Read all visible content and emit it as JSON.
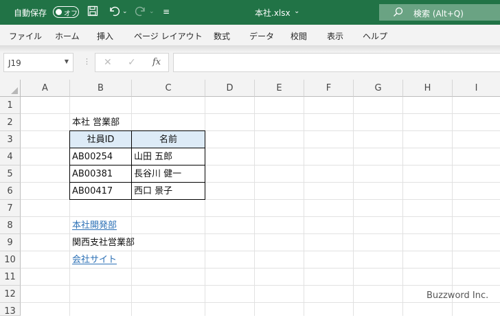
{
  "titlebar": {
    "autosave_label": "自動保存",
    "autosave_state": "オフ",
    "filename": "本社.xlsx",
    "search_label": "検索 (Alt+Q)",
    "bg_color": "#217346"
  },
  "ribbon": {
    "tabs": [
      "ファイル",
      "ホーム",
      "挿入",
      "ページ レイアウト",
      "数式",
      "データ",
      "校閲",
      "表示",
      "ヘルプ"
    ]
  },
  "formula_bar": {
    "name_box": "J19",
    "fx_label": "fx",
    "formula": ""
  },
  "sheet": {
    "columns": [
      "A",
      "B",
      "C",
      "D",
      "E",
      "F",
      "G",
      "H",
      "I"
    ],
    "rows": [
      "1",
      "2",
      "3",
      "4",
      "5",
      "6",
      "7",
      "8",
      "9",
      "10",
      "11",
      "12",
      "13"
    ],
    "cells": {
      "B2": "本社 営業部",
      "B3": "社員ID",
      "C3": "名前",
      "B4": "AB00254",
      "C4": "山田 五郎",
      "B5": "AB00381",
      "C5": "長谷川 健一",
      "B6": "AB00417",
      "C6": "西口 景子",
      "B8": "本社開発部",
      "B9": "関西支社営業部",
      "B10": "会社サイト"
    },
    "header_fill": "#ddebf7",
    "link_color": "#2a6fb5"
  },
  "watermark": "Buzzword Inc."
}
